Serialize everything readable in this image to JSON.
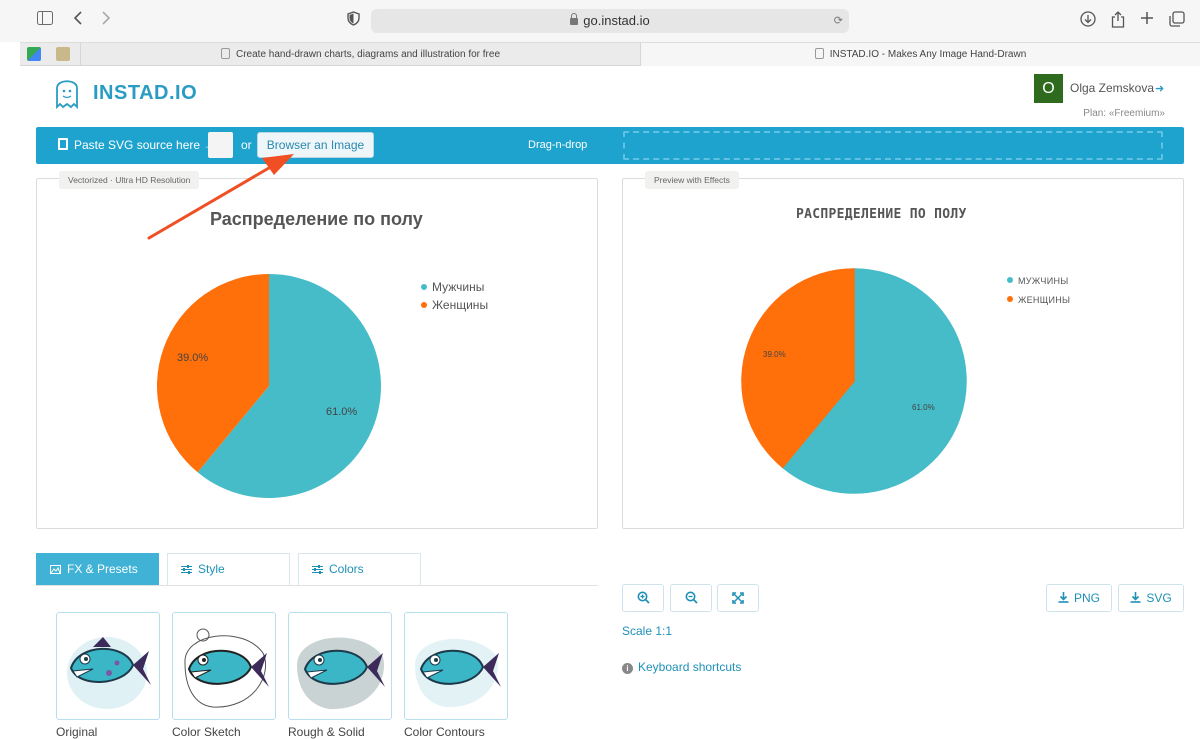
{
  "browser": {
    "url": "go.instad.io",
    "tabs": [
      {
        "title": "Create hand-drawn charts, diagrams and illustration for free"
      },
      {
        "title": "INSTAD.IO - Makes Any Image Hand-Drawn"
      }
    ]
  },
  "header": {
    "logo": "INSTAD.IO",
    "avatar_letter": "O",
    "user_name": "Olga Zemskova",
    "plan": "Plan: «Freemium»"
  },
  "upload": {
    "paste_label": "Paste SVG source here →",
    "or": "or",
    "browse_label": "Browser an Image",
    "dnd_label": "Drag-n-drop"
  },
  "left_panel": {
    "tag": "Vectorized · Ultra HD Resolution",
    "chart": {
      "title": "Распределение по полу",
      "legend": [
        "Мужчины",
        "Женщины"
      ],
      "labels": [
        "61.0%",
        "39.0%"
      ]
    }
  },
  "right_panel": {
    "tag": "Preview with Effects",
    "chart": {
      "title": "РАСПРЕДЕЛЕНИЕ ПО ПОЛУ",
      "legend": [
        "МУЖЧИНЫ",
        "ЖЕНЩИНЫ"
      ],
      "labels": [
        "61.0%",
        "39.0%"
      ]
    }
  },
  "chart_data": {
    "type": "pie",
    "title": "Распределение по полу",
    "categories": [
      "Мужчины",
      "Женщины"
    ],
    "values": [
      61.0,
      39.0
    ],
    "colors": [
      "#45bcc8",
      "#ff6f0a"
    ],
    "legend_position": "right"
  },
  "tools": {
    "tabs": [
      "FX & Presets",
      "Style",
      "Colors"
    ],
    "presets": [
      "Original",
      "Color Sketch",
      "Rough & Solid",
      "Color Contours"
    ]
  },
  "controls": {
    "png": "PNG",
    "svg": "SVG",
    "scale": "Scale 1:1",
    "shortcuts": "Keyboard shortcuts"
  },
  "colors": {
    "accent": "#1ea3cf",
    "teal": "#45bcc8",
    "orange": "#ff6f0a",
    "arrow": "#f04e23"
  }
}
